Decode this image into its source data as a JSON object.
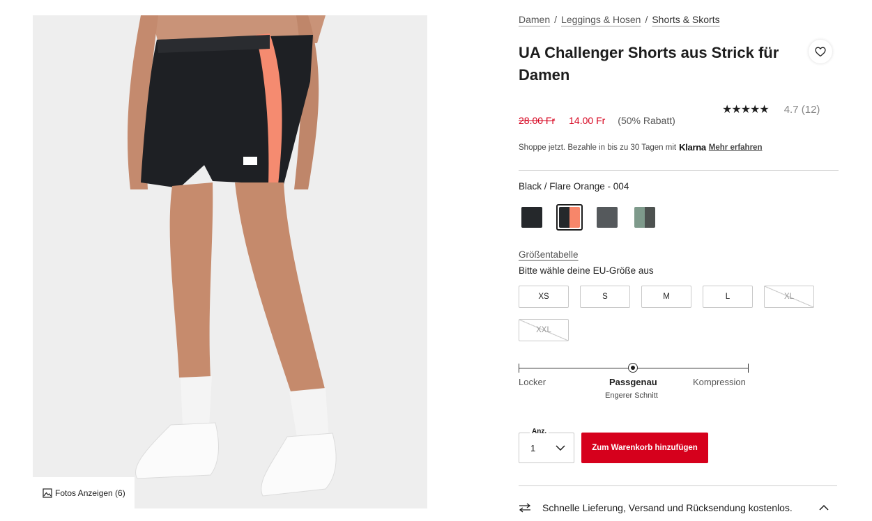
{
  "breadcrumb": [
    {
      "label": "Damen"
    },
    {
      "label": "Leggings & Hosen"
    },
    {
      "label": "Shorts & Skorts"
    }
  ],
  "breadcrumb_separator": "/",
  "product": {
    "title": "UA Challenger Shorts aus Strick für Damen",
    "rating_stars": 4.7,
    "stars_display": "★★★★★",
    "rating_text": "4.7 (12)",
    "price_old": "28.00 Fr",
    "price_new": "14.00 Fr",
    "discount": "(50% Rabatt)"
  },
  "klarna": {
    "text": "Shoppe jetzt. Bezahle in bis zu 30 Tagen mit",
    "brand": "Klarna",
    "link": "Mehr erfahren"
  },
  "color": {
    "label": "Black / Flare Orange - 004",
    "swatches": [
      {
        "colors": [
          "#25282b"
        ],
        "selected": false
      },
      {
        "colors": [
          "#25282b",
          "#f7866a"
        ],
        "selected": true
      },
      {
        "colors": [
          "#55595c"
        ],
        "selected": false
      },
      {
        "colors": [
          "#7e9a8b",
          "#4d5250"
        ],
        "selected": false
      }
    ]
  },
  "size": {
    "chart_link": "Größentabelle",
    "prompt": "Bitte wähle deine EU-Größe aus",
    "options": [
      {
        "label": "XS",
        "available": true
      },
      {
        "label": "S",
        "available": true
      },
      {
        "label": "M",
        "available": true
      },
      {
        "label": "L",
        "available": true
      },
      {
        "label": "XL",
        "available": false
      },
      {
        "label": "XXL",
        "available": false
      }
    ]
  },
  "fit": {
    "left": "Locker",
    "middle": "Passgenau",
    "right": "Kompression",
    "sub": "Engerer Schnitt",
    "position": 0.5
  },
  "quantity": {
    "label": "Anz.",
    "value": "1"
  },
  "cart_button": "Zum Warenkorb hinzufügen",
  "shipping": "Schnelle Lieferung, Versand und Rücksendung kostenlos.",
  "photos_button": "Fotos Anzeigen (6)",
  "colors": {
    "accent_red": "#d6001c"
  }
}
